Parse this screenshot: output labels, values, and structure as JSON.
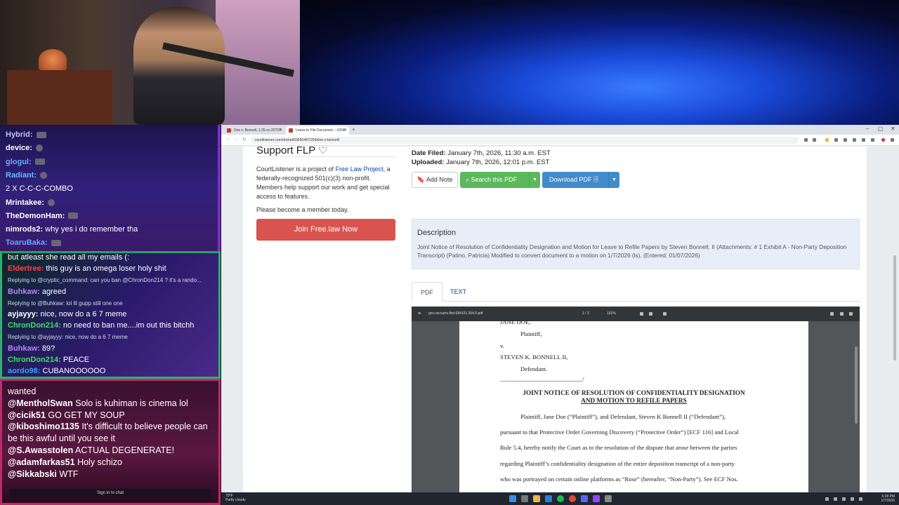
{
  "chat": {
    "panel1": [
      {
        "user": "Hybrid:",
        "color": "#c0c0ff",
        "text": ""
      },
      {
        "user": "device:",
        "color": "#ffffff",
        "text": ""
      },
      {
        "user": "glogul:",
        "color": "#66aaff",
        "text": ""
      },
      {
        "user": "Radiant:",
        "color": "#66bbff",
        "text": ""
      },
      {
        "user": "",
        "color": "#ffffff",
        "text": "2 X C-C-C-COMBO"
      },
      {
        "user": "Mrintakee:",
        "color": "#ffffff",
        "text": ""
      },
      {
        "user": "TheDemonHam:",
        "color": "#ffffff",
        "text": ""
      },
      {
        "user": "nimrods2:",
        "color": "#ffffff",
        "text": "why yes i do remember tha"
      },
      {
        "user": "ToaruBaka:",
        "color": "#66aaff",
        "text": ""
      }
    ],
    "panel2": [
      {
        "user": "",
        "color": "#ffffff",
        "text": "but atleast she read all my emails (:"
      },
      {
        "user": "Eldertree:",
        "color": "#ff4040",
        "text": "this guy is an omega loser holy shit"
      },
      {
        "reply": "Replying to @cryptic_command: can you ban @ChronDon214 ? it's a rando..."
      },
      {
        "user": "Buhkaw:",
        "color": "#c080ff",
        "text": "agreed"
      },
      {
        "reply": "Replying to @Buhkaw: lol lil gupp still one one"
      },
      {
        "user": "ayjayyy:",
        "color": "#ffffff",
        "text": "nice, now do a 6 7 meme"
      },
      {
        "user": "ChronDon214:",
        "color": "#40e060",
        "text": "no need to ban me....im out this bitchh"
      },
      {
        "reply": "Replying to @ayjayyy: nice, now do a 6 7 meme"
      },
      {
        "user": "Buhkaw:",
        "color": "#c080ff",
        "text": "89?"
      },
      {
        "user": "ChronDon214:",
        "color": "#40e060",
        "text": "PEACE"
      },
      {
        "user": "aordo98:",
        "color": "#40a0ff",
        "text": "CUBANOOOOOO"
      }
    ],
    "panel3": [
      {
        "user": "",
        "text": "wanted"
      },
      {
        "user": "@MentholSwan",
        "text": "Solo is kuhiman is cinema lol"
      },
      {
        "user": "@cicik51",
        "text": "GO GET MY SOUP"
      },
      {
        "user": "@kiboshimo1135",
        "text": "It's difficult to believe people can"
      },
      {
        "user": "",
        "text": "be this awful until you see it"
      },
      {
        "user": "@S.Awasstolen",
        "text": "ACTUAL DEGENERATE!"
      },
      {
        "user": "@adamfarkas51",
        "text": "Holy schizo"
      },
      {
        "user": "@Sikkabski",
        "text": "WTF"
      }
    ],
    "signin_label": "Sign in to chat"
  },
  "browser": {
    "tabs": [
      {
        "label": "Doe v. Bonnell, 1:25-cv-20757"
      },
      {
        "label": "Leave to File Document – #204"
      }
    ],
    "url": "courtlistener.com/docket/69650487/204/doe-v-bonnell/"
  },
  "sidebar": {
    "title": "Support FLP ♡",
    "about_pre": "CourtListener is a project of ",
    "about_link": "Free Law Project",
    "about_post": ", a federally-recognized 501(c)(3) non-profit. Members help support our work and get special access to features.",
    "member_text": "Please become a member today.",
    "join_label": "Join Free.law Now"
  },
  "document": {
    "date_filed_label": "Date Filed:",
    "date_filed": "January 7th, 2026, 11:30 a.m. EST",
    "uploaded_label": "Uploaded:",
    "uploaded": "January 7th, 2026, 12:01 p.m. EST",
    "add_note_label": "Add Note",
    "search_pdf_label": "Search this PDF",
    "download_pdf_label": "Download PDF",
    "description_title": "Description",
    "description_text": "Joint Notice of Resolution of Confidentiality Designation and Motion for Leave to Refile Papers by Steven Bonnell, II (Attachments: # 1 Exhibit A - Non-Party Deposition Transcript) (Patino, Patricia) Modified to convert document to a motion on 1/7/2026 (ls). (Entered: 01/07/2026)",
    "tab_pdf": "PDF",
    "tab_text": "TEXT"
  },
  "viewer": {
    "filename": "gov.uscourts.flsd.684191.204.0.pdf",
    "page": "1 / 3",
    "zoom": "101%",
    "lines": [
      "JANE DOE,",
      "Plaintiff,",
      "v.",
      "STEVEN K. BONNELL II,",
      "Defendant.",
      "___________________________/"
    ],
    "title1": "JOINT NOTICE OF RESOLUTION OF CONFIDENTIALITY DESIGNATION",
    "title2": "AND MOTION TO REFILE PAPERS",
    "body": [
      "Plaintiff, Jane Doe (“Plaintiff”), and Defendant, Steven K Bonnell II (“Defendant”),",
      "pursuant to that Protective Order Governing Discovery (“Protective Order”) [ECF 116] and Local",
      "Rule 5.4, hereby notify the Court as to the resolution of the dispute that arose between the parties",
      "regarding Plaintiff’s confidentiality designation of the entire deposition transcript of a non-party",
      "who was portrayed on certain online platforms as “Rose” (hereafter, “Non-Party”). See ECF Nos."
    ]
  },
  "taskbar": {
    "temp": "70°F",
    "weather": "Partly cloudy",
    "time": "6:28 PM",
    "date": "1/7/2026"
  }
}
